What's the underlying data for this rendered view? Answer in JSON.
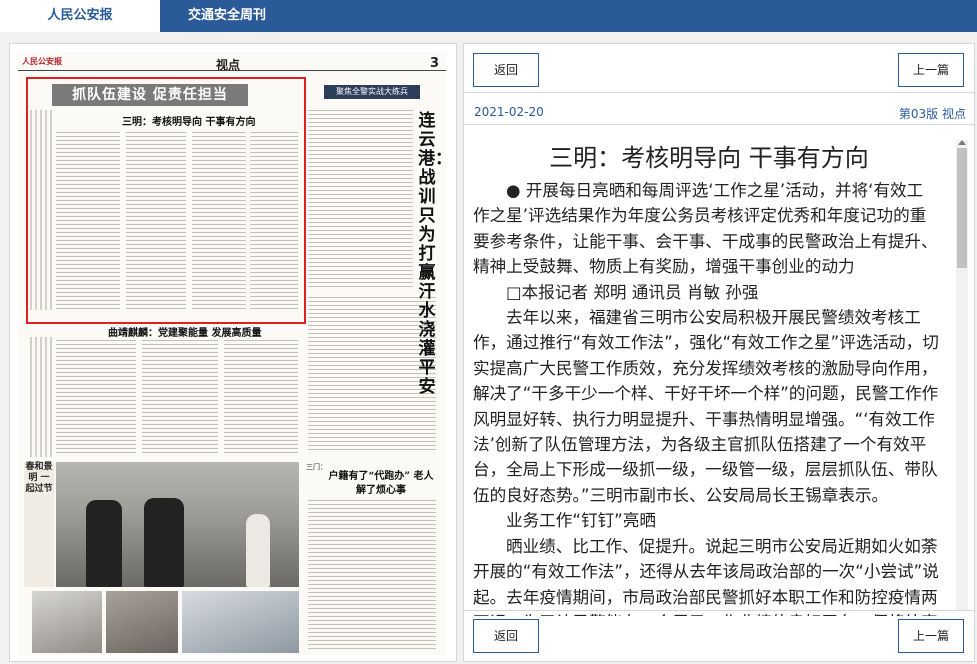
{
  "tabs": [
    {
      "label": "人民公安报",
      "active": true
    },
    {
      "label": "交通安全周刊",
      "active": false
    }
  ],
  "newspaper": {
    "section": "视点",
    "page_number": "3",
    "highlight_banner": "抓队伍建设 促责任担当",
    "highlight_title": "三明：考核明导向 干事有方向",
    "side_banner": "聚焦全警实战大练兵",
    "side_vertical_title": "连云港：战训只为打赢 汗水浇灌平安",
    "middle_title": "曲靖麒麟：党建聚能量 发展高质量",
    "bottom_section": "三门：",
    "bottom_title": "户籍有了“代跑办” 老人解了烦心事",
    "photo_caption": "春和景明 一起过节"
  },
  "toolbar": {
    "back_label": "返回",
    "prev_label": "上一篇"
  },
  "meta": {
    "date": "2021-02-20",
    "edition": "第03版 视点"
  },
  "article": {
    "title": "三明：考核明导向 干事有方向",
    "paragraphs": [
      "● 开展每日亮晒和每周评选‘工作之星’活动，并将‘有效工作之星’评选结果作为年度公务员考核评定优秀和年度记功的重要参考条件，让能干事、会干事、干成事的民警政治上有提升、精神上受鼓舞、物质上有奖励，增强干事创业的动力",
      "□本报记者 郑明 通讯员 肖敏 孙强",
      "去年以来，福建省三明市公安局积极开展民警绩效考核工作，通过推行“有效工作法”，强化“有效工作之星”评选活动，切实提高广大民警工作质效，充分发挥绩效考核的激励导向作用，解决了“干多干少一个样、干好干坏一个样”的问题，民警工作作风明显好转、执行力明显提升、干事热情明显增强。“‘有效工作法’创新了队伍管理方法，为各级主官抓队伍搭建了一个有效平台，全局上下形成一级抓一级，一级管一级，层层抓队伍、带队伍的良好态势。”三明市副市长、公安局局长王锡章表示。",
      "业务工作“钉钉”亮晒",
      "晒业绩、比工作、促提升。说起三明市公安局近期如火如荼开展的“有效工作法”，还得从去年该局政治部的一次“小尝试”说起。去年疫情期间，市局政治部民警抓好本职工作和防控疫情两不误，为了让民警能有一个展示工作业绩的良好平台，便将处室全体民警"
    ]
  },
  "colors": {
    "brand_blue": "#2a5a98",
    "highlight_red": "#e02020"
  }
}
